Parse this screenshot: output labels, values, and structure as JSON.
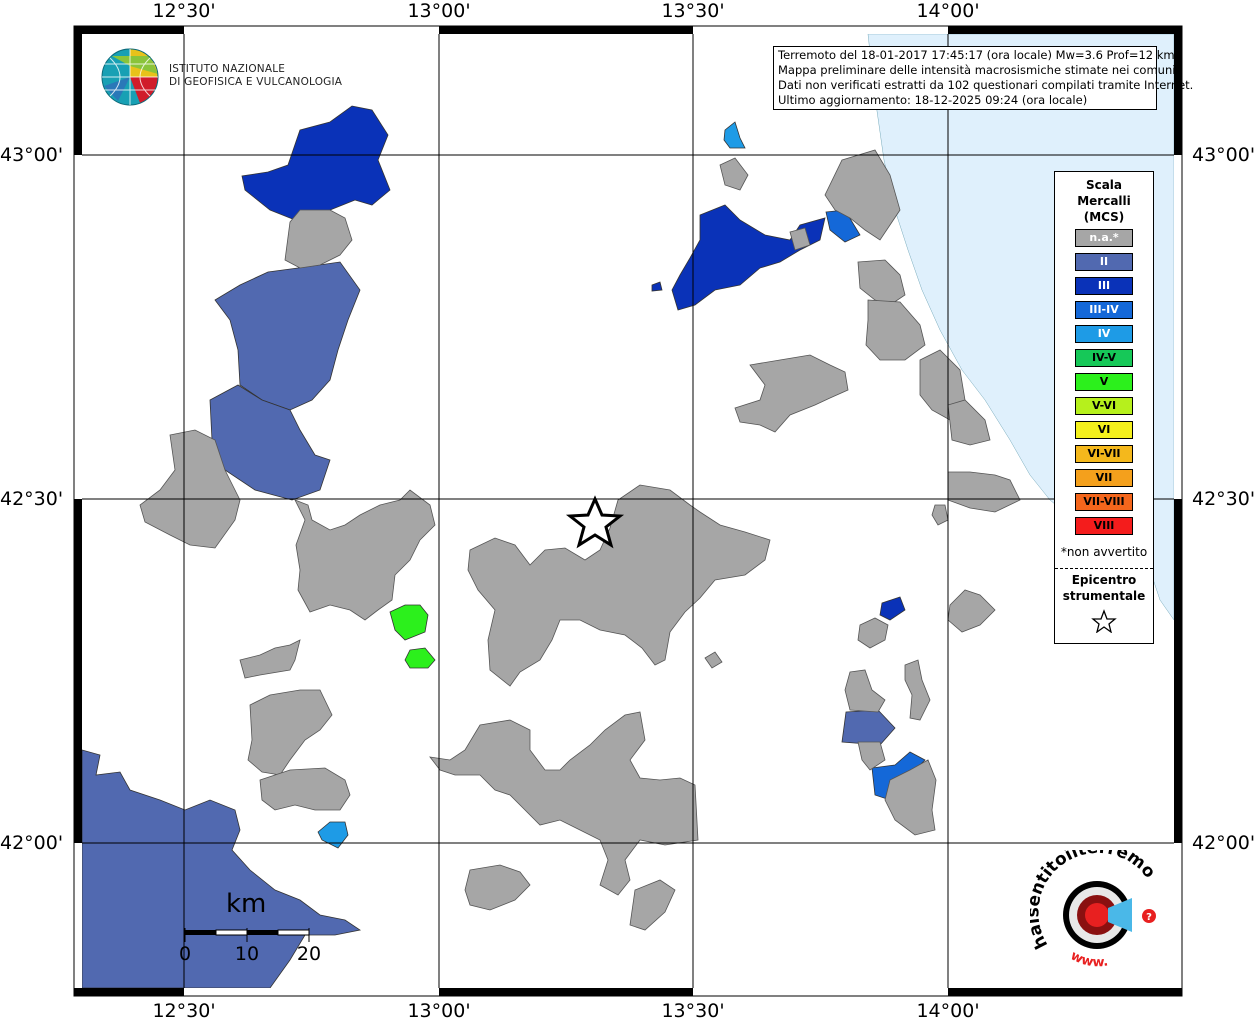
{
  "header": {
    "lon_labels": [
      "12°30'",
      "13°00'",
      "13°30'",
      "14°00'"
    ],
    "lat_labels": [
      "43°00'",
      "42°30'",
      "42°00'"
    ]
  },
  "logo": {
    "line1": "ISTITUTO NAZIONALE",
    "line2": "DI GEOFISICA E VULCANOLOGIA"
  },
  "info": {
    "line1": "Terremoto del 18-01-2017 17:45:17 (ora locale) Mw=3.6 Prof=12 km",
    "line2": "Mappa preliminare delle intensità macrosismiche stimate nei comuni",
    "line3": "Dati non verificati estratti da 102 questionari compilati tramite Internet.",
    "line4": "Ultimo aggiornamento: 18-12-2025 09:24 (ora locale)"
  },
  "legend": {
    "title_line1": "Scala",
    "title_line2": "Mercalli",
    "title_line3": "(MCS)",
    "items": [
      {
        "label": "n.a.*",
        "color": "#a6a6a6"
      },
      {
        "label": "II",
        "color": "#5169b0"
      },
      {
        "label": "III",
        "color": "#0a32b8"
      },
      {
        "label": "III-IV",
        "color": "#1468d8"
      },
      {
        "label": "IV",
        "color": "#1e9be6"
      },
      {
        "label": "IV-V",
        "color": "#16c858"
      },
      {
        "label": "V",
        "color": "#2cf01c"
      },
      {
        "label": "V-VI",
        "color": "#b6f01c"
      },
      {
        "label": "VI",
        "color": "#f4f01c"
      },
      {
        "label": "VI-VII",
        "color": "#f4b81c"
      },
      {
        "label": "VII",
        "color": "#f4a01c"
      },
      {
        "label": "VII-VIII",
        "color": "#f4661c"
      },
      {
        "label": "VIII",
        "color": "#f41c1c"
      }
    ],
    "na_note": "*non avvertito",
    "epicenter_line1": "Epicentro",
    "epicenter_line2": "strumentale"
  },
  "scale_bar": {
    "unit": "km",
    "ticks": [
      "0",
      "10",
      "20"
    ]
  },
  "badge": {
    "text": "haisentitoilterremoto.it",
    "www": "www."
  },
  "colors": {
    "sea": "#dff0fc",
    "na": "#a6a6a6",
    "ii": "#5169b0",
    "iii": "#0a32b8",
    "iii_iv": "#1468d8",
    "iv": "#1e9be6",
    "v": "#2cf01c"
  }
}
